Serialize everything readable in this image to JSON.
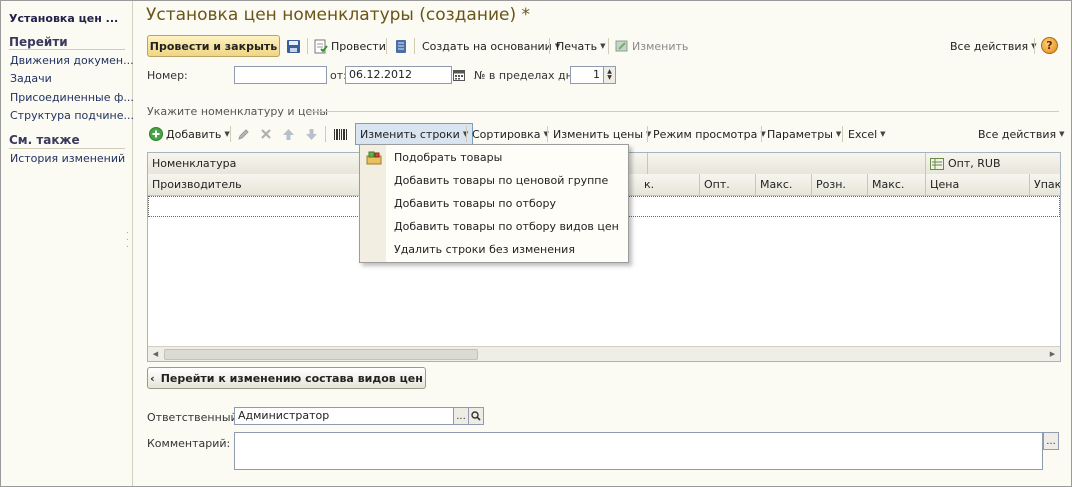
{
  "sidebar": {
    "title": "Установка цен ...",
    "go_section": "Перейти",
    "go_items": [
      "Движения докумен...",
      "Задачи",
      "Присоединенные ф...",
      "Структура подчине..."
    ],
    "see_also_section": "См. также",
    "see_also_items": [
      "История изменений"
    ]
  },
  "page_title": "Установка цен номенклатуры (создание) *",
  "toolbar": {
    "post_close": "Провести и закрыть",
    "post": "Провести",
    "create_based": "Создать на основании",
    "print": "Печать",
    "edit": "Изменить",
    "all_actions": "Все действия"
  },
  "header_fields": {
    "number_label": "Номер:",
    "number_value": "",
    "date_label": "от:",
    "date_value": "06.12.2012",
    "day_no_label": "№ в пределах дня:",
    "day_no_value": "1"
  },
  "group_label": "Укажите номенклатуру и цены",
  "table_toolbar": {
    "add": "Добавить",
    "edit_rows": "Изменить строки",
    "sort": "Сортировка",
    "change_prices": "Изменить цены",
    "view_mode": "Режим просмотра",
    "params": "Параметры",
    "excel": "Excel",
    "all_actions": "Все действия"
  },
  "table": {
    "header1": {
      "nomenclature": "Номенклатура",
      "price_type": "Опт, RUB"
    },
    "header2": [
      "Производитель",
      "к.",
      "Опт.",
      "Макс.",
      "Розн.",
      "Макс.",
      "Цена",
      "Упак"
    ]
  },
  "dropdown": {
    "items": [
      "Подобрать товары",
      "Добавить товары по ценовой группе",
      "Добавить товары по отбору",
      "Добавить товары по отбору видов цен",
      "Удалить строки без изменения"
    ]
  },
  "back_button": "Перейти к изменению состава видов цен",
  "footer": {
    "responsible_label": "Ответственный:",
    "responsible_value": "Администратор",
    "comment_label": "Комментарий:",
    "comment_value": ""
  },
  "colors": {
    "title": "#6a5518",
    "accent_button": "#efd584",
    "panel_bg": "#fbfbf3"
  }
}
